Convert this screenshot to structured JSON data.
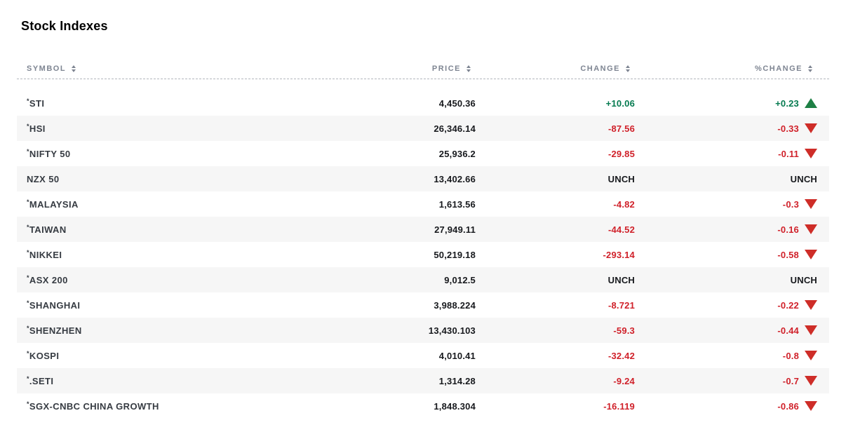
{
  "page": {
    "title": "Stock Indexes"
  },
  "table": {
    "headers": {
      "symbol": "SYMBOL",
      "price": "PRICE",
      "change": "CHANGE",
      "pct_change": "%CHANGE"
    },
    "rows": [
      {
        "asterisk": "*",
        "symbol": "STI",
        "price": "4,450.36",
        "change": "+10.06",
        "pct_change": "+0.23",
        "direction": "up"
      },
      {
        "asterisk": "*",
        "symbol": "HSI",
        "price": "26,346.14",
        "change": "-87.56",
        "pct_change": "-0.33",
        "direction": "down"
      },
      {
        "asterisk": "*",
        "symbol": "NIFTY 50",
        "price": "25,936.2",
        "change": "-29.85",
        "pct_change": "-0.11",
        "direction": "down"
      },
      {
        "asterisk": "",
        "symbol": "NZX 50",
        "price": "13,402.66",
        "change": "UNCH",
        "pct_change": "UNCH",
        "direction": "none"
      },
      {
        "asterisk": "*",
        "symbol": "MALAYSIA",
        "price": "1,613.56",
        "change": "-4.82",
        "pct_change": "-0.3",
        "direction": "down"
      },
      {
        "asterisk": "*",
        "symbol": "TAIWAN",
        "price": "27,949.11",
        "change": "-44.52",
        "pct_change": "-0.16",
        "direction": "down"
      },
      {
        "asterisk": "*",
        "symbol": "NIKKEI",
        "price": "50,219.18",
        "change": "-293.14",
        "pct_change": "-0.58",
        "direction": "down"
      },
      {
        "asterisk": "*",
        "symbol": "ASX 200",
        "price": "9,012.5",
        "change": "UNCH",
        "pct_change": "UNCH",
        "direction": "none"
      },
      {
        "asterisk": "*",
        "symbol": "SHANGHAI",
        "price": "3,988.224",
        "change": "-8.721",
        "pct_change": "-0.22",
        "direction": "down"
      },
      {
        "asterisk": "*",
        "symbol": "SHENZHEN",
        "price": "13,430.103",
        "change": "-59.3",
        "pct_change": "-0.44",
        "direction": "down"
      },
      {
        "asterisk": "*",
        "symbol": "KOSPI",
        "price": "4,010.41",
        "change": "-32.42",
        "pct_change": "-0.8",
        "direction": "down"
      },
      {
        "asterisk": "*",
        "symbol": ".SETI",
        "price": "1,314.28",
        "change": "-9.24",
        "pct_change": "-0.7",
        "direction": "down"
      },
      {
        "asterisk": "*",
        "symbol": "SGX-CNBC CHINA GROWTH",
        "price": "1,848.304",
        "change": "-16.119",
        "pct_change": "-0.86",
        "direction": "down"
      }
    ]
  },
  "colors": {
    "positive_text": "#047a4f",
    "negative_text": "#d0212a",
    "positive_arrow": "#1e8045",
    "negative_arrow": "#ce2d28",
    "header_text": "#7e8592",
    "row_stripe": "#f6f6f6",
    "value_text": "#17191d",
    "symbol_text": "#363b42"
  }
}
